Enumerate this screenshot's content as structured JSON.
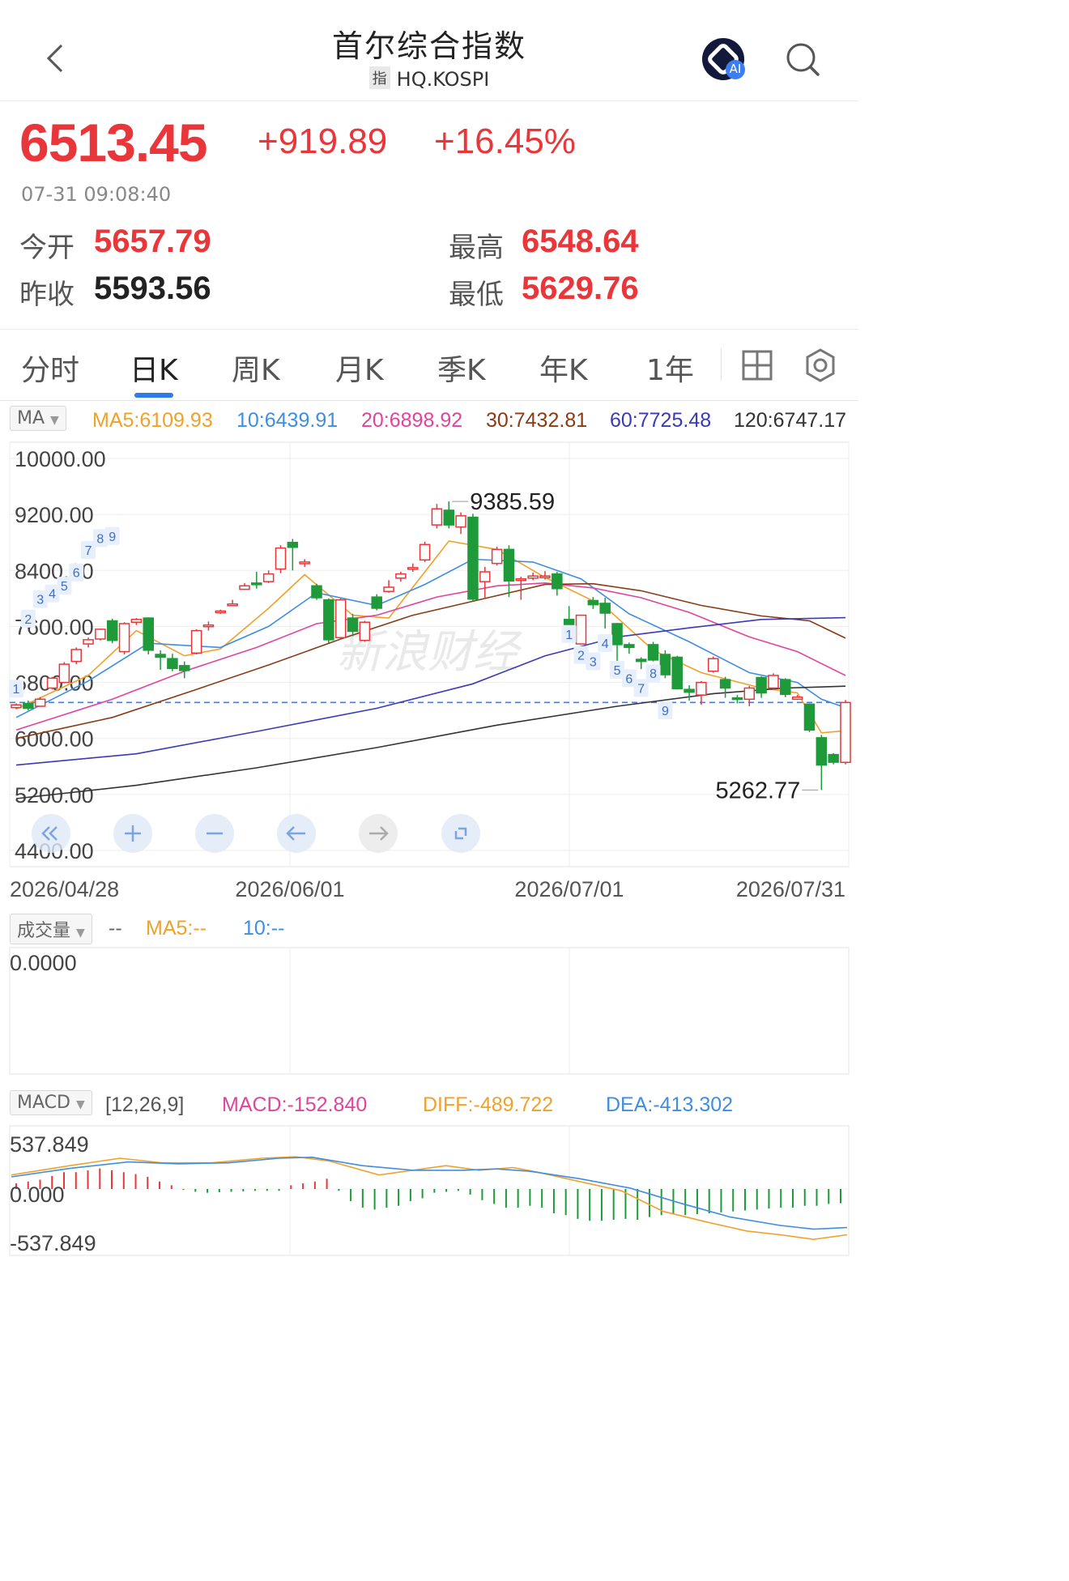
{
  "header": {
    "title": "首尔综合指数",
    "code_tag": "指",
    "code": "HQ.KOSPI",
    "ai_label": "AI"
  },
  "quote": {
    "price": "6513.45",
    "change": "+919.89",
    "change_pct": "+16.45%",
    "time": "07-31 09:08:40",
    "open_label": "今开",
    "open": "5657.79",
    "prev_close_label": "昨收",
    "prev_close": "5593.56",
    "high_label": "最高",
    "high": "6548.64",
    "low_label": "最低",
    "low": "5629.76"
  },
  "tabs": [
    "分时",
    "日K",
    "周K",
    "月K",
    "季K",
    "年K",
    "1年"
  ],
  "active_tab": "日K",
  "ma_legend": {
    "selector": "MA",
    "items": [
      {
        "text": "MA5:6109.93",
        "color": "#f0a12a"
      },
      {
        "text": "10:6439.91",
        "color": "#3f8ee0"
      },
      {
        "text": "20:6898.92",
        "color": "#e0449c"
      },
      {
        "text": "30:7432.81",
        "color": "#8a3b16"
      },
      {
        "text": "60:7725.48",
        "color": "#3a3ab8"
      },
      {
        "text": "120:6747.17",
        "color": "#333333"
      }
    ]
  },
  "volume_legend": {
    "selector": "成交量",
    "dash": "--",
    "items": [
      {
        "text": "MA5:--",
        "color": "#f0a12a"
      },
      {
        "text": "10:--",
        "color": "#3f8ee0"
      }
    ],
    "y_label": "0.0000"
  },
  "macd_legend": {
    "selector": "MACD",
    "params": "[12,26,9]",
    "items": [
      {
        "text": "MACD:-152.840",
        "color": "#e0449c"
      },
      {
        "text": "DIFF:-489.722",
        "color": "#f0a12a"
      },
      {
        "text": "DEA:-413.302",
        "color": "#3f8ee0"
      }
    ],
    "y_labels": [
      "537.849",
      "0.000",
      "-537.849"
    ]
  },
  "chart_data": [
    {
      "type": "candlestick",
      "y_labels": [
        "10000.00",
        "9200.00",
        "8400.00",
        "7600.00",
        "6800.00",
        "6000.00",
        "5200.00",
        "4400.00"
      ],
      "ylim": [
        4400,
        10000
      ],
      "x_labels": [
        "2026/04/28",
        "2026/06/01",
        "2026/07/01",
        "2026/07/31"
      ],
      "annotations": {
        "max": "9385.59",
        "min": "5262.77"
      },
      "reference_line": 6514,
      "watermark": "新浪财经",
      "seq_markers": [
        "9",
        "1",
        "2",
        "3",
        "4",
        "5",
        "6",
        "7",
        "8",
        "9"
      ],
      "candles": [
        {
          "o": 6440,
          "c": 6480,
          "h": 6500,
          "l": 6420
        },
        {
          "o": 6500,
          "c": 6430,
          "h": 6540,
          "l": 6400
        },
        {
          "o": 6460,
          "c": 6560,
          "h": 6590,
          "l": 6450
        },
        {
          "o": 6720,
          "c": 6860,
          "h": 6880,
          "l": 6700
        },
        {
          "o": 6800,
          "c": 7060,
          "h": 7090,
          "l": 6790
        },
        {
          "o": 7100,
          "c": 7270,
          "h": 7300,
          "l": 7060
        },
        {
          "o": 7350,
          "c": 7410,
          "h": 7440,
          "l": 7300
        },
        {
          "o": 7420,
          "c": 7560,
          "h": 7570,
          "l": 7400
        },
        {
          "o": 7680,
          "c": 7400,
          "h": 7710,
          "l": 7360
        },
        {
          "o": 7240,
          "c": 7640,
          "h": 7660,
          "l": 7200
        },
        {
          "o": 7660,
          "c": 7700,
          "h": 7720,
          "l": 7620
        },
        {
          "o": 7720,
          "c": 7260,
          "h": 7730,
          "l": 7200
        },
        {
          "o": 7200,
          "c": 7160,
          "h": 7260,
          "l": 6980
        },
        {
          "o": 7140,
          "c": 7000,
          "h": 7210,
          "l": 6960
        },
        {
          "o": 7040,
          "c": 6970,
          "h": 7100,
          "l": 6860
        },
        {
          "o": 7220,
          "c": 7540,
          "h": 7560,
          "l": 7200
        },
        {
          "o": 7600,
          "c": 7620,
          "h": 7670,
          "l": 7540
        },
        {
          "o": 7820,
          "c": 7820,
          "h": 7840,
          "l": 7780
        },
        {
          "o": 7920,
          "c": 7920,
          "h": 7980,
          "l": 7900
        },
        {
          "o": 8130,
          "c": 8180,
          "h": 8220,
          "l": 8120
        },
        {
          "o": 8220,
          "c": 8200,
          "h": 8380,
          "l": 8140
        },
        {
          "o": 8240,
          "c": 8350,
          "h": 8400,
          "l": 8220
        },
        {
          "o": 8420,
          "c": 8720,
          "h": 8760,
          "l": 8360
        },
        {
          "o": 8800,
          "c": 8730,
          "h": 8850,
          "l": 8400
        },
        {
          "o": 8520,
          "c": 8520,
          "h": 8560,
          "l": 8450
        },
        {
          "o": 8180,
          "c": 8010,
          "h": 8210,
          "l": 7980
        },
        {
          "o": 7980,
          "c": 7410,
          "h": 8000,
          "l": 7360
        },
        {
          "o": 7440,
          "c": 7980,
          "h": 8000,
          "l": 7420
        },
        {
          "o": 7720,
          "c": 7530,
          "h": 7780,
          "l": 7460
        },
        {
          "o": 7400,
          "c": 7660,
          "h": 7680,
          "l": 7380
        },
        {
          "o": 8020,
          "c": 7860,
          "h": 8060,
          "l": 7830
        },
        {
          "o": 8100,
          "c": 8160,
          "h": 8260,
          "l": 8080
        },
        {
          "o": 8290,
          "c": 8350,
          "h": 8380,
          "l": 8240
        },
        {
          "o": 8420,
          "c": 8440,
          "h": 8500,
          "l": 8380
        },
        {
          "o": 8550,
          "c": 8770,
          "h": 8810,
          "l": 8520
        },
        {
          "o": 9050,
          "c": 9280,
          "h": 9350,
          "l": 9000
        },
        {
          "o": 9260,
          "c": 9050,
          "h": 9386,
          "l": 9000
        },
        {
          "o": 9020,
          "c": 9180,
          "h": 9230,
          "l": 8920
        },
        {
          "o": 9160,
          "c": 7990,
          "h": 9210,
          "l": 7960
        },
        {
          "o": 8240,
          "c": 8380,
          "h": 8450,
          "l": 8010
        },
        {
          "o": 8500,
          "c": 8700,
          "h": 8740,
          "l": 8470
        },
        {
          "o": 8700,
          "c": 8250,
          "h": 8760,
          "l": 8020
        },
        {
          "o": 8280,
          "c": 8280,
          "h": 8310,
          "l": 7980
        },
        {
          "o": 8290,
          "c": 8320,
          "h": 8370,
          "l": 8260
        },
        {
          "o": 8310,
          "c": 8320,
          "h": 8390,
          "l": 8270
        },
        {
          "o": 8350,
          "c": 8140,
          "h": 8380,
          "l": 8040
        },
        {
          "o": 7700,
          "c": 7420,
          "h": 7890,
          "l": 7400
        },
        {
          "o": 7350,
          "c": 7760,
          "h": 7770,
          "l": 7340
        },
        {
          "o": 7970,
          "c": 7910,
          "h": 8020,
          "l": 7850
        },
        {
          "o": 7930,
          "c": 7790,
          "h": 8010,
          "l": 7570
        },
        {
          "o": 7640,
          "c": 7340,
          "h": 7650,
          "l": 7090
        },
        {
          "o": 7340,
          "c": 7300,
          "h": 7370,
          "l": 7210
        },
        {
          "o": 7130,
          "c": 7100,
          "h": 7160,
          "l": 6990
        },
        {
          "o": 7340,
          "c": 7120,
          "h": 7380,
          "l": 7100
        },
        {
          "o": 7200,
          "c": 6910,
          "h": 7260,
          "l": 6860
        },
        {
          "o": 7160,
          "c": 6710,
          "h": 7180,
          "l": 6700
        },
        {
          "o": 6700,
          "c": 6660,
          "h": 6760,
          "l": 6540
        },
        {
          "o": 6620,
          "c": 6800,
          "h": 6820,
          "l": 6480
        },
        {
          "o": 6960,
          "c": 7140,
          "h": 7170,
          "l": 6940
        },
        {
          "o": 6840,
          "c": 6720,
          "h": 6880,
          "l": 6580
        },
        {
          "o": 6580,
          "c": 6560,
          "h": 6620,
          "l": 6500
        },
        {
          "o": 6560,
          "c": 6720,
          "h": 6750,
          "l": 6460
        },
        {
          "o": 6870,
          "c": 6650,
          "h": 6890,
          "l": 6580
        },
        {
          "o": 6720,
          "c": 6900,
          "h": 6930,
          "l": 6700
        },
        {
          "o": 6840,
          "c": 6630,
          "h": 6860,
          "l": 6590
        },
        {
          "o": 6560,
          "c": 6590,
          "h": 6620,
          "l": 6550
        },
        {
          "o": 6490,
          "c": 6120,
          "h": 6500,
          "l": 6090
        },
        {
          "o": 6010,
          "c": 5620,
          "h": 6050,
          "l": 5263
        },
        {
          "o": 5770,
          "c": 5660,
          "h": 5790,
          "l": 5630
        },
        {
          "o": 5658,
          "c": 6513,
          "h": 6549,
          "l": 5630
        }
      ],
      "ma_lines": [
        {
          "name": "MA5",
          "color": "#f0a12a",
          "points": [
            [
              0,
              6420
            ],
            [
              6,
              6900
            ],
            [
              10,
              7540
            ],
            [
              14,
              7180
            ],
            [
              17,
              7280
            ],
            [
              21,
              7860
            ],
            [
              24,
              8340
            ],
            [
              28,
              7760
            ],
            [
              31,
              7720
            ],
            [
              36,
              8820
            ],
            [
              40,
              8700
            ],
            [
              44,
              8300
            ],
            [
              49,
              7880
            ],
            [
              53,
              7260
            ],
            [
              57,
              6940
            ],
            [
              62,
              6720
            ],
            [
              65,
              6650
            ],
            [
              67,
              6080
            ],
            [
              69,
              6110
            ]
          ]
        },
        {
          "name": "MA10",
          "color": "#3f8ee0",
          "points": [
            [
              0,
              6300
            ],
            [
              6,
              6820
            ],
            [
              11,
              7360
            ],
            [
              17,
              7300
            ],
            [
              21,
              7600
            ],
            [
              25,
              8080
            ],
            [
              30,
              7900
            ],
            [
              34,
              8200
            ],
            [
              38,
              8560
            ],
            [
              43,
              8520
            ],
            [
              47,
              8280
            ],
            [
              51,
              7780
            ],
            [
              56,
              7380
            ],
            [
              61,
              6940
            ],
            [
              65,
              6800
            ],
            [
              67,
              6560
            ],
            [
              69,
              6440
            ]
          ]
        },
        {
          "name": "MA20",
          "color": "#e0449c",
          "points": [
            [
              0,
              6120
            ],
            [
              8,
              6560
            ],
            [
              14,
              6960
            ],
            [
              20,
              7300
            ],
            [
              25,
              7640
            ],
            [
              30,
              7760
            ],
            [
              35,
              8020
            ],
            [
              40,
              8180
            ],
            [
              44,
              8220
            ],
            [
              48,
              8150
            ],
            [
              52,
              8010
            ],
            [
              56,
              7800
            ],
            [
              61,
              7450
            ],
            [
              65,
              7240
            ],
            [
              69,
              6899
            ]
          ]
        },
        {
          "name": "MA30",
          "color": "#8a3b16",
          "points": [
            [
              0,
              6000
            ],
            [
              8,
              6300
            ],
            [
              15,
              6700
            ],
            [
              21,
              7050
            ],
            [
              27,
              7420
            ],
            [
              33,
              7760
            ],
            [
              39,
              8000
            ],
            [
              44,
              8200
            ],
            [
              48,
              8210
            ],
            [
              52,
              8110
            ],
            [
              57,
              7900
            ],
            [
              62,
              7750
            ],
            [
              66,
              7680
            ],
            [
              69,
              7433
            ]
          ]
        },
        {
          "name": "MA60",
          "color": "#3a3ab8",
          "points": [
            [
              0,
              5620
            ],
            [
              10,
              5780
            ],
            [
              20,
              6100
            ],
            [
              30,
              6430
            ],
            [
              38,
              6780
            ],
            [
              44,
              7180
            ],
            [
              50,
              7450
            ],
            [
              56,
              7580
            ],
            [
              62,
              7700
            ],
            [
              69,
              7725
            ]
          ]
        },
        {
          "name": "MA120",
          "color": "#333333",
          "points": [
            [
              0,
              5140
            ],
            [
              10,
              5330
            ],
            [
              20,
              5580
            ],
            [
              30,
              5870
            ],
            [
              40,
              6190
            ],
            [
              50,
              6460
            ],
            [
              58,
              6640
            ],
            [
              64,
              6720
            ],
            [
              69,
              6747
            ]
          ]
        }
      ]
    },
    {
      "type": "bar",
      "name": "volume",
      "ylabel": "",
      "y_labels": [
        "0.0000"
      ],
      "values": []
    },
    {
      "type": "bar+line",
      "name": "MACD",
      "ylim": [
        -537.849,
        537.849
      ],
      "macd_hist": [
        60,
        80,
        100,
        140,
        180,
        180,
        200,
        220,
        200,
        180,
        160,
        130,
        80,
        40,
        -10,
        -30,
        -40,
        -35,
        -30,
        -25,
        -20,
        -20,
        -20,
        40,
        60,
        80,
        110,
        -20,
        -130,
        -200,
        -220,
        -200,
        -180,
        -130,
        -100,
        -40,
        -30,
        -20,
        -60,
        -120,
        -160,
        -200,
        -200,
        -180,
        -200,
        -260,
        -280,
        -320,
        -340,
        -340,
        -330,
        -320,
        -330,
        -300,
        -280,
        -270,
        -280,
        -270,
        -260,
        -250,
        -240,
        -230,
        -220,
        -210,
        -200,
        -200,
        -180,
        -180,
        -160,
        -153
      ],
      "diff_line": [
        [
          0,
          150
        ],
        [
          7,
          250
        ],
        [
          13,
          330
        ],
        [
          18,
          280
        ],
        [
          24,
          280
        ],
        [
          30,
          330
        ],
        [
          34,
          345
        ],
        [
          38,
          300
        ],
        [
          44,
          150
        ],
        [
          48,
          200
        ],
        [
          52,
          250
        ],
        [
          56,
          200
        ],
        [
          60,
          230
        ],
        [
          63,
          180
        ],
        [
          68,
          80
        ],
        [
          73,
          -20
        ],
        [
          78,
          -240
        ],
        [
          83,
          -350
        ],
        [
          88,
          -450
        ],
        [
          92,
          -490
        ],
        [
          96,
          -540
        ],
        [
          100,
          -490
        ]
      ],
      "dea_line": [
        [
          0,
          130
        ],
        [
          7,
          220
        ],
        [
          14,
          290
        ],
        [
          20,
          270
        ],
        [
          26,
          280
        ],
        [
          32,
          330
        ],
        [
          36,
          340
        ],
        [
          42,
          250
        ],
        [
          48,
          200
        ],
        [
          54,
          200
        ],
        [
          58,
          215
        ],
        [
          62,
          190
        ],
        [
          68,
          110
        ],
        [
          74,
          10
        ],
        [
          80,
          -150
        ],
        [
          86,
          -300
        ],
        [
          92,
          -390
        ],
        [
          96,
          -430
        ],
        [
          100,
          -413
        ]
      ]
    }
  ],
  "chart_controls": [
    "double-left",
    "zoom-in",
    "zoom-out",
    "pan-left",
    "pan-right",
    "fullscreen"
  ]
}
